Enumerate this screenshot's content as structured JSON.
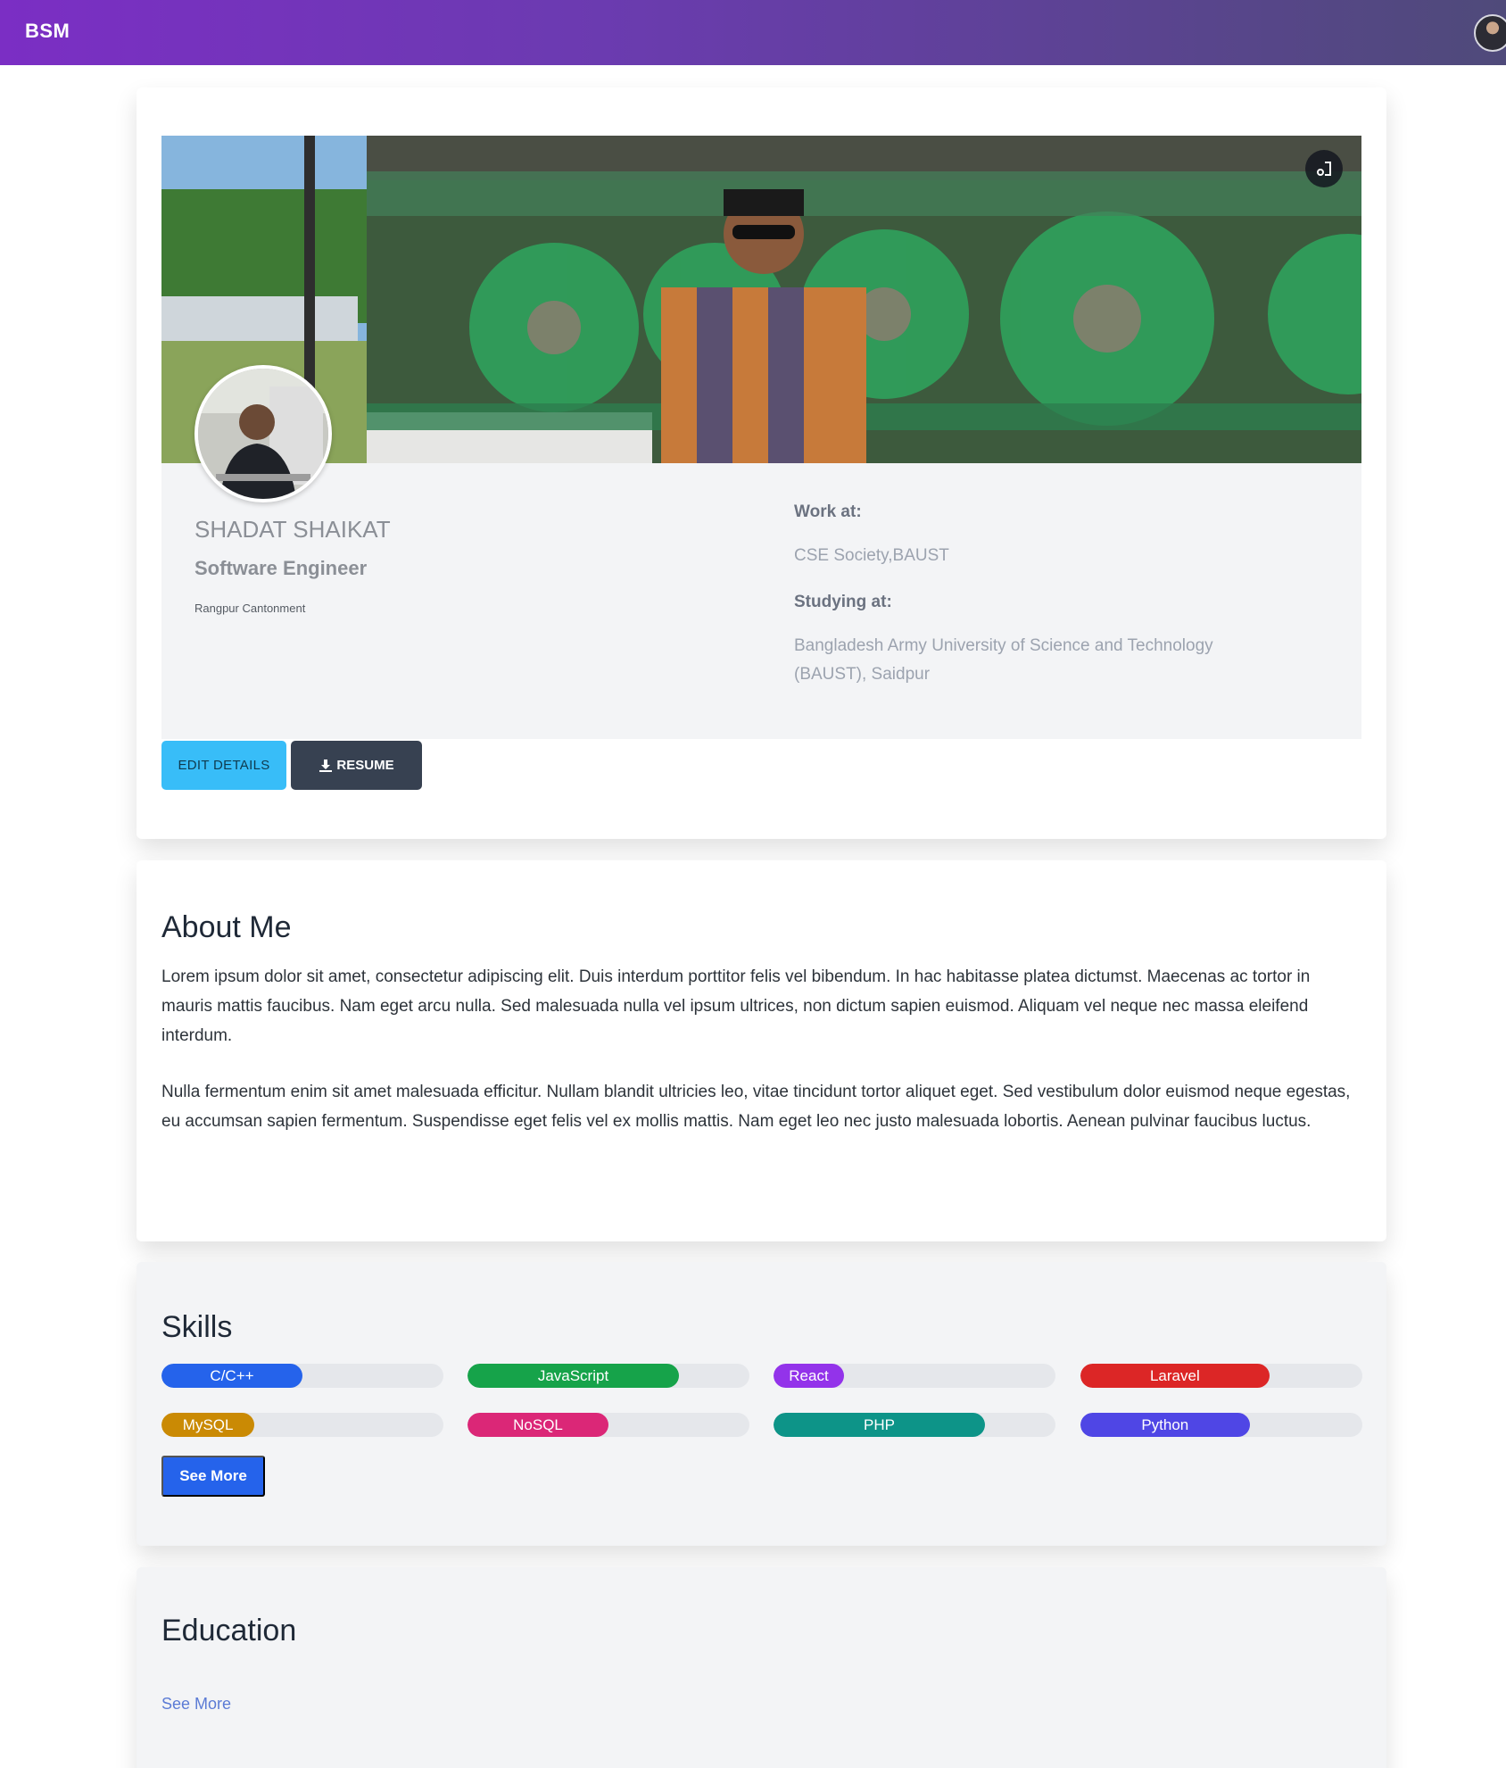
{
  "navbar": {
    "brand": "BSM"
  },
  "profile": {
    "name": "SHADAT SHAIKAT",
    "role": "Software Engineer",
    "location": "Rangpur Cantonment",
    "work_label": "Work at:",
    "work_value": "CSE Society,BAUST",
    "study_label": "Studying at:",
    "study_value_line1": "Bangladesh Army University of Science and Technology",
    "study_value_line2": "(BAUST), Saidpur",
    "edit_button": "EDIT DETAILS",
    "resume_button": "RESUME"
  },
  "about": {
    "title": "About Me",
    "paragraph1": "Lorem ipsum dolor sit amet, consectetur adipiscing elit. Duis interdum porttitor felis vel bibendum. In hac habitasse platea dictumst. Maecenas ac tortor in mauris mattis faucibus. Nam eget arcu nulla. Sed malesuada nulla vel ipsum ultrices, non dictum sapien euismod. Aliquam vel neque nec massa eleifend interdum.",
    "paragraph2": "Nulla fermentum enim sit amet malesuada efficitur. Nullam blandit ultricies leo, vitae tincidunt tortor aliquet eget. Sed vestibulum dolor euismod neque egestas, eu accumsan sapien fermentum. Suspendisse eget felis vel ex mollis mattis. Nam eget leo nec justo malesuada lobortis. Aenean pulvinar faucibus luctus."
  },
  "skills": {
    "title": "Skills",
    "items": [
      {
        "name": "C/C++",
        "level": 50,
        "color": "#2563eb"
      },
      {
        "name": "JavaScript",
        "level": 75,
        "color": "#16a34a"
      },
      {
        "name": "React",
        "level": 25,
        "color": "#9333ea"
      },
      {
        "name": "Laravel",
        "level": 67,
        "color": "#dc2626"
      },
      {
        "name": "MySQL",
        "level": 33,
        "color": "#ca8a04"
      },
      {
        "name": "NoSQL",
        "level": 50,
        "color": "#db2777"
      },
      {
        "name": "PHP",
        "level": 75,
        "color": "#0d9488"
      },
      {
        "name": "Python",
        "level": 60,
        "color": "#4f46e5"
      }
    ],
    "see_more": "See More"
  },
  "education": {
    "title": "Education",
    "see_more": "See More"
  },
  "icons": {
    "expand": "expand-icon",
    "download": "download-icon",
    "avatar": "avatar-icon"
  },
  "colors": {
    "nav_gradient_start": "#7b2ec4",
    "nav_gradient_end": "#4f4a7a",
    "accent": "#2563eb",
    "edit_button": "#38bdf8",
    "resume_button": "#374151"
  }
}
